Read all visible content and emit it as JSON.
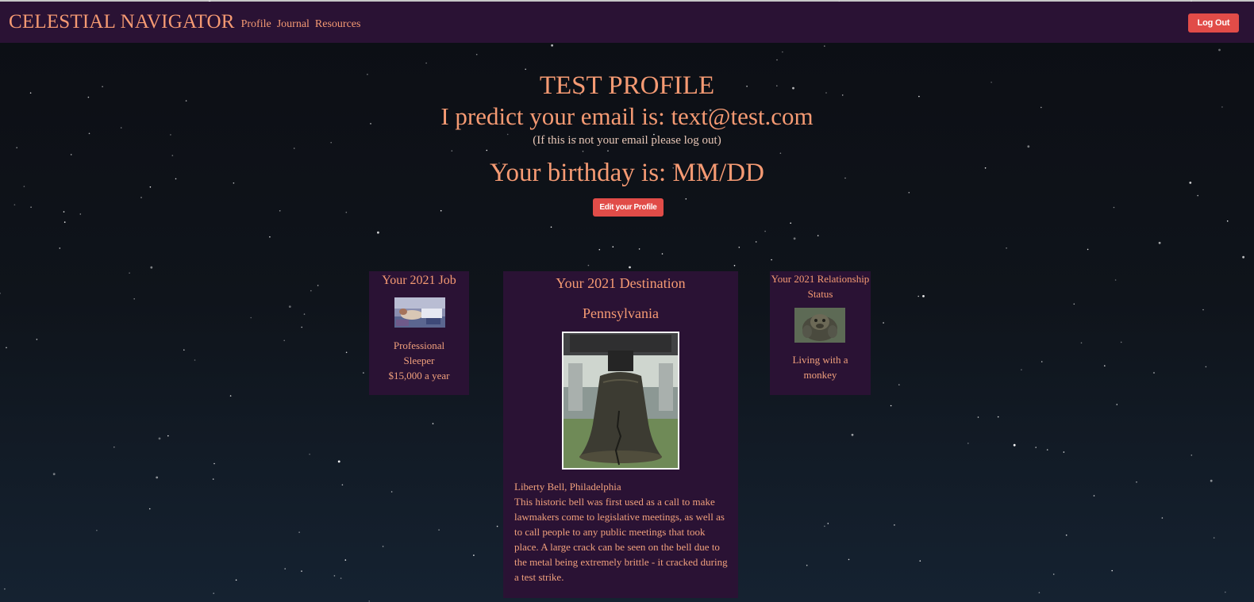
{
  "navbar": {
    "brand": "CELESTIAL NAVIGATOR",
    "links": [
      "Profile",
      "Journal",
      "Resources"
    ],
    "logout_label": "Log Out"
  },
  "hero": {
    "title": "TEST PROFILE",
    "email_line": "I predict your email is: text@test.com",
    "email_note": "(If this is not your email please log out)",
    "birthday_line": "Your birthday is: MM/DD",
    "edit_label": "Edit your Profile"
  },
  "cards": {
    "job": {
      "title": "Your 2021 Job",
      "name_line1": "Professional",
      "name_line2": "Sleeper",
      "salary": "$15,000 a year"
    },
    "destination": {
      "title": "Your 2021 Destination",
      "place": "Pennsylvania",
      "landmark": "Liberty Bell, Philadelphia",
      "description": "This historic bell was first used as a call to make lawmakers come to legislative meetings, as well as to call people to any public meetings that took place. A large crack can be seen on the bell due to the metal being extremely brittle - it cracked during a test strike."
    },
    "relationship": {
      "title_line1": "Your 2021 Relationship",
      "title_line2": "Status",
      "status_line1": "Living with a",
      "status_line2": "monkey"
    }
  },
  "colors": {
    "navbar_bg": "#2a1234",
    "accent_text": "#f59a73",
    "button_red": "#e14c48",
    "page_bg": "#0f141b"
  },
  "icons": [
    "sleeping-person-photo",
    "liberty-bell-photo",
    "monkey-photo"
  ]
}
